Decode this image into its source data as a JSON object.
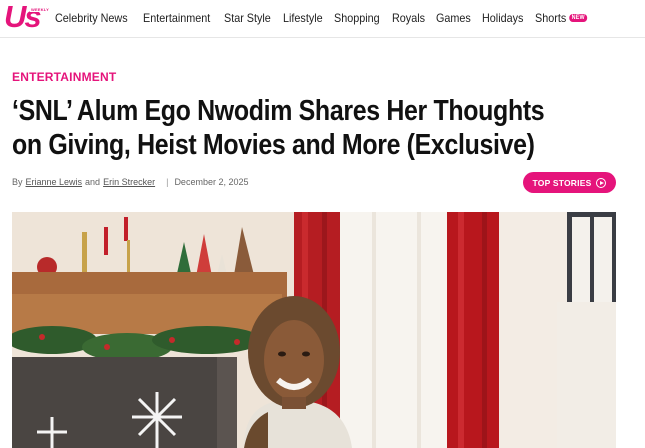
{
  "header": {
    "logo_text": "Us",
    "logo_subtext": "WEEKLY",
    "nav": [
      {
        "label": "Celebrity News"
      },
      {
        "label": "Entertainment"
      },
      {
        "label": "Star Style"
      },
      {
        "label": "Lifestyle"
      },
      {
        "label": "Shopping"
      },
      {
        "label": "Royals"
      },
      {
        "label": "Games"
      },
      {
        "label": "Holidays"
      },
      {
        "label": "Shorts",
        "badge": "NEW"
      }
    ]
  },
  "article": {
    "category": "ENTERTAINMENT",
    "title": "‘SNL’ Alum Ego Nwodim Shares Her Thoughts on Giving, Heist Movies and More (Exclusive)",
    "byline": {
      "prefix": "By",
      "author1": "Erianne Lewis",
      "conjunction": "and",
      "author2": "Erin Strecker",
      "separator": "|",
      "date": "December 2, 2025"
    },
    "top_stories_label": "TOP STORIES"
  },
  "colors": {
    "brand": "#e5147b",
    "text": "#111111"
  }
}
